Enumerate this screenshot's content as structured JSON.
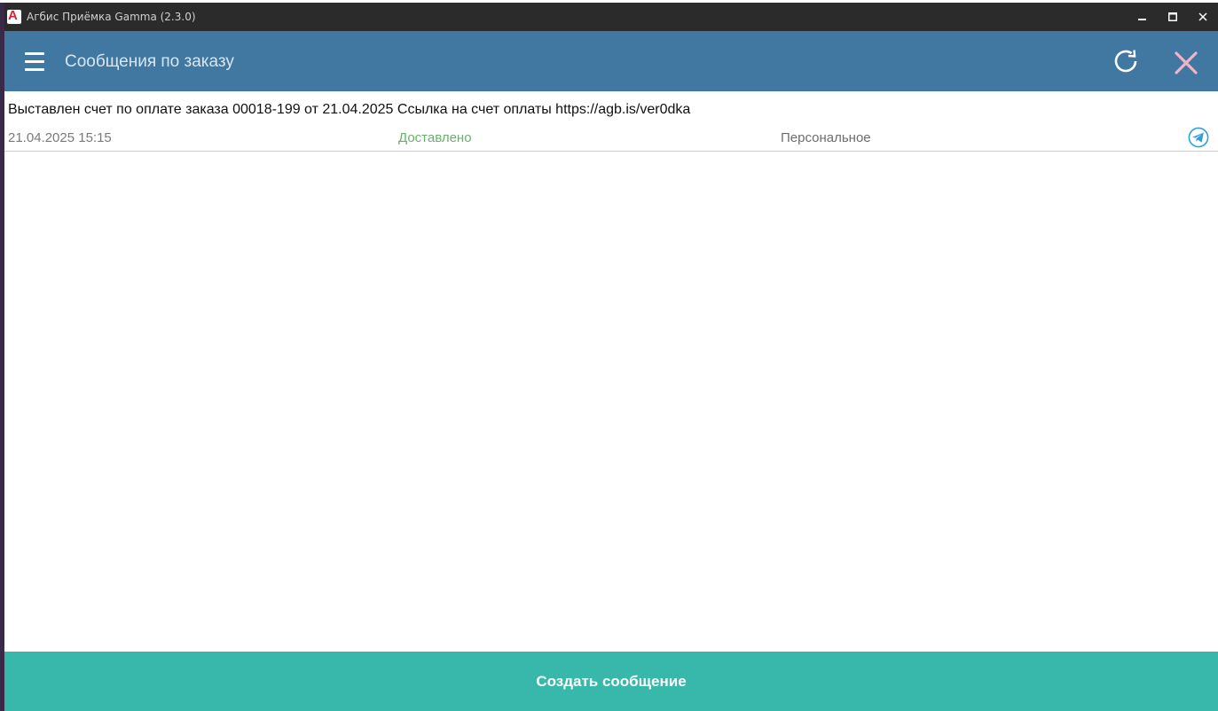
{
  "window": {
    "title": "Агбис Приёмка Gamma (2.3.0)",
    "logo_letter": "A",
    "controls": {
      "minimize": "▁",
      "maximize": "▭",
      "close": "✕"
    }
  },
  "header": {
    "title": "Сообщения по заказу",
    "menu_icon": "hamburger-menu-icon",
    "refresh_icon": "refresh-icon",
    "close_icon": "close-icon",
    "bg_color": "#4078a2",
    "close_color": "#f2b3c4"
  },
  "messages": [
    {
      "text": "Выставлен счет по оплате заказа 00018-199 от 21.04.2025 Ссылка на счет оплаты https://agb.is/ver0dka",
      "datetime": "21.04.2025 15:15",
      "status": "Доставлено",
      "type": "Персональное",
      "channel_icon": "telegram-icon",
      "status_color": "#6cae70"
    }
  ],
  "footer": {
    "create_button_label": "Создать сообщение",
    "button_color": "#37b8aa"
  }
}
